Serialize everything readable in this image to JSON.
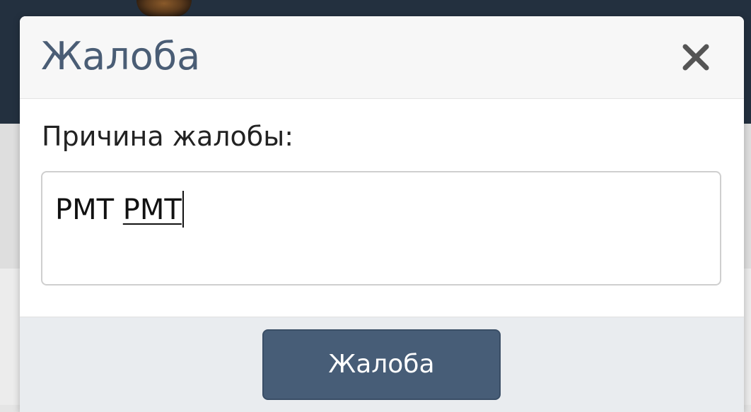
{
  "dialog": {
    "title": "Жалоба",
    "close_icon": "close-icon",
    "reason_label": "Причина жалобы:",
    "reason_value_first_word": "PMT",
    "reason_value_second_word": "PMT",
    "submit_label": "Жалоба"
  },
  "colors": {
    "title": "#4a5d75",
    "button_background": "#475d77",
    "header_background": "#23303f",
    "footer_background": "#e9ecef"
  }
}
